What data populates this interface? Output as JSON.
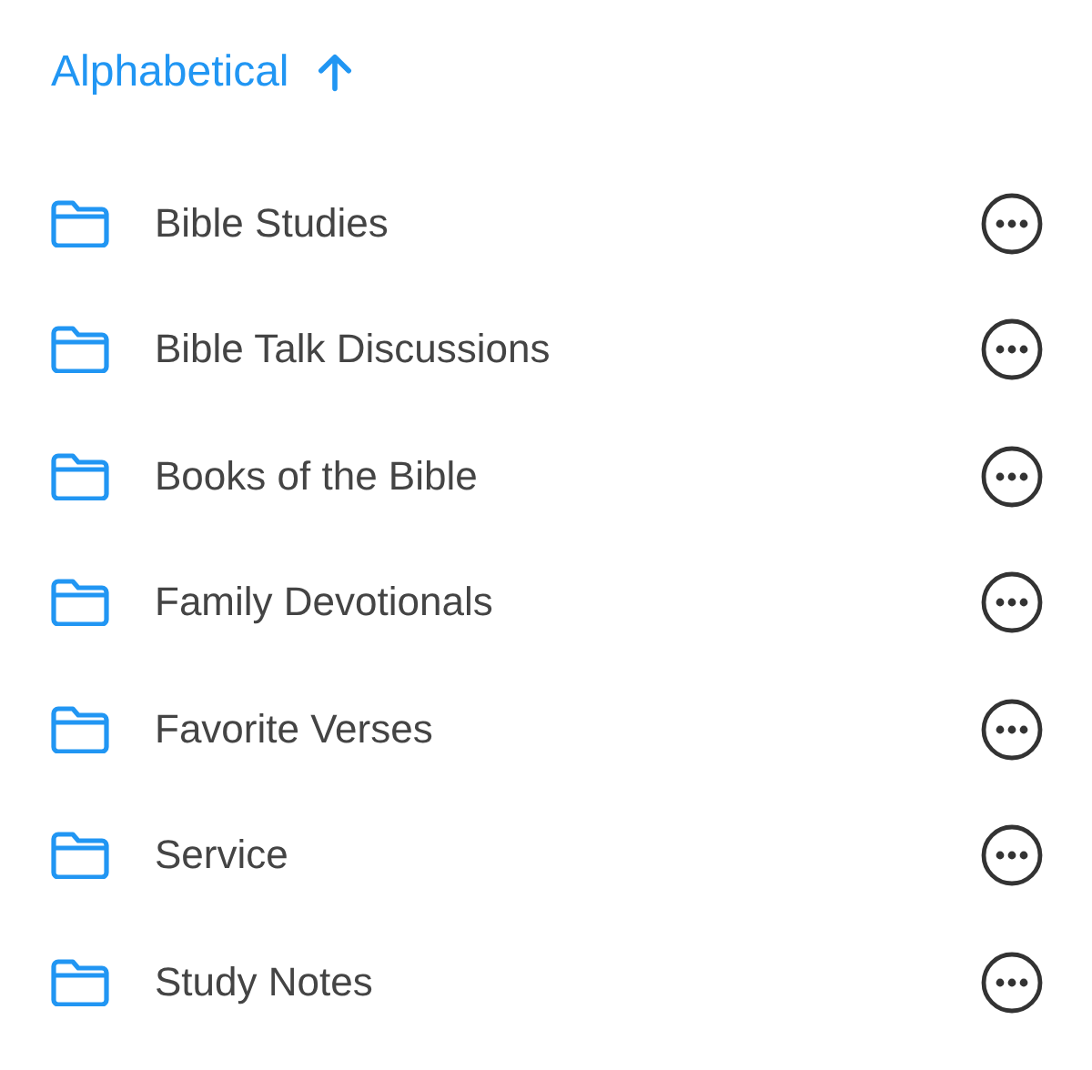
{
  "sort": {
    "label": "Alphabetical",
    "ascending": true
  },
  "folders": [
    {
      "name": "Bible Studies"
    },
    {
      "name": "Bible Talk Discussions"
    },
    {
      "name": "Books of the Bible"
    },
    {
      "name": "Family Devotionals"
    },
    {
      "name": "Favorite Verses"
    },
    {
      "name": "Service"
    },
    {
      "name": "Study Notes"
    }
  ]
}
